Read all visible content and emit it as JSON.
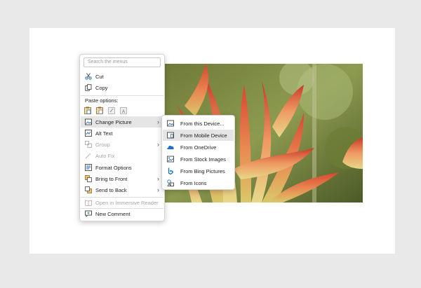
{
  "context_menu": {
    "search_placeholder": "Search the menus",
    "cut": "Cut",
    "copy": "Copy",
    "paste_options_label": "Paste options:",
    "change_picture": "Change Picture",
    "alt_text": "Alt Text",
    "group": "Group",
    "auto_fix": "Auto Fix",
    "format_options": "Format Options",
    "bring_to_front": "Bring to Front",
    "send_to_back": "Send to Back",
    "open_immersive_reader": "Open in Immersive Reader",
    "new_comment": "New Comment"
  },
  "submenu": {
    "items": [
      {
        "label": "From this Device...",
        "icon": "device-image-icon"
      },
      {
        "label": "From Mobile Device",
        "icon": "mobile-image-icon",
        "highlighted": true
      },
      {
        "label": "From OneDrive",
        "icon": "onedrive-cloud-icon"
      },
      {
        "label": "From Stock Images",
        "icon": "stock-image-icon"
      },
      {
        "label": "From Bing Pictures",
        "icon": "bing-logo-icon"
      },
      {
        "label": "From Icons",
        "icon": "icons-shapes-icon"
      }
    ]
  },
  "colors": {
    "accent_blue": "#2b6cb0",
    "highlight": "#e5e5e5",
    "disabled_text": "#a6a6a6"
  }
}
